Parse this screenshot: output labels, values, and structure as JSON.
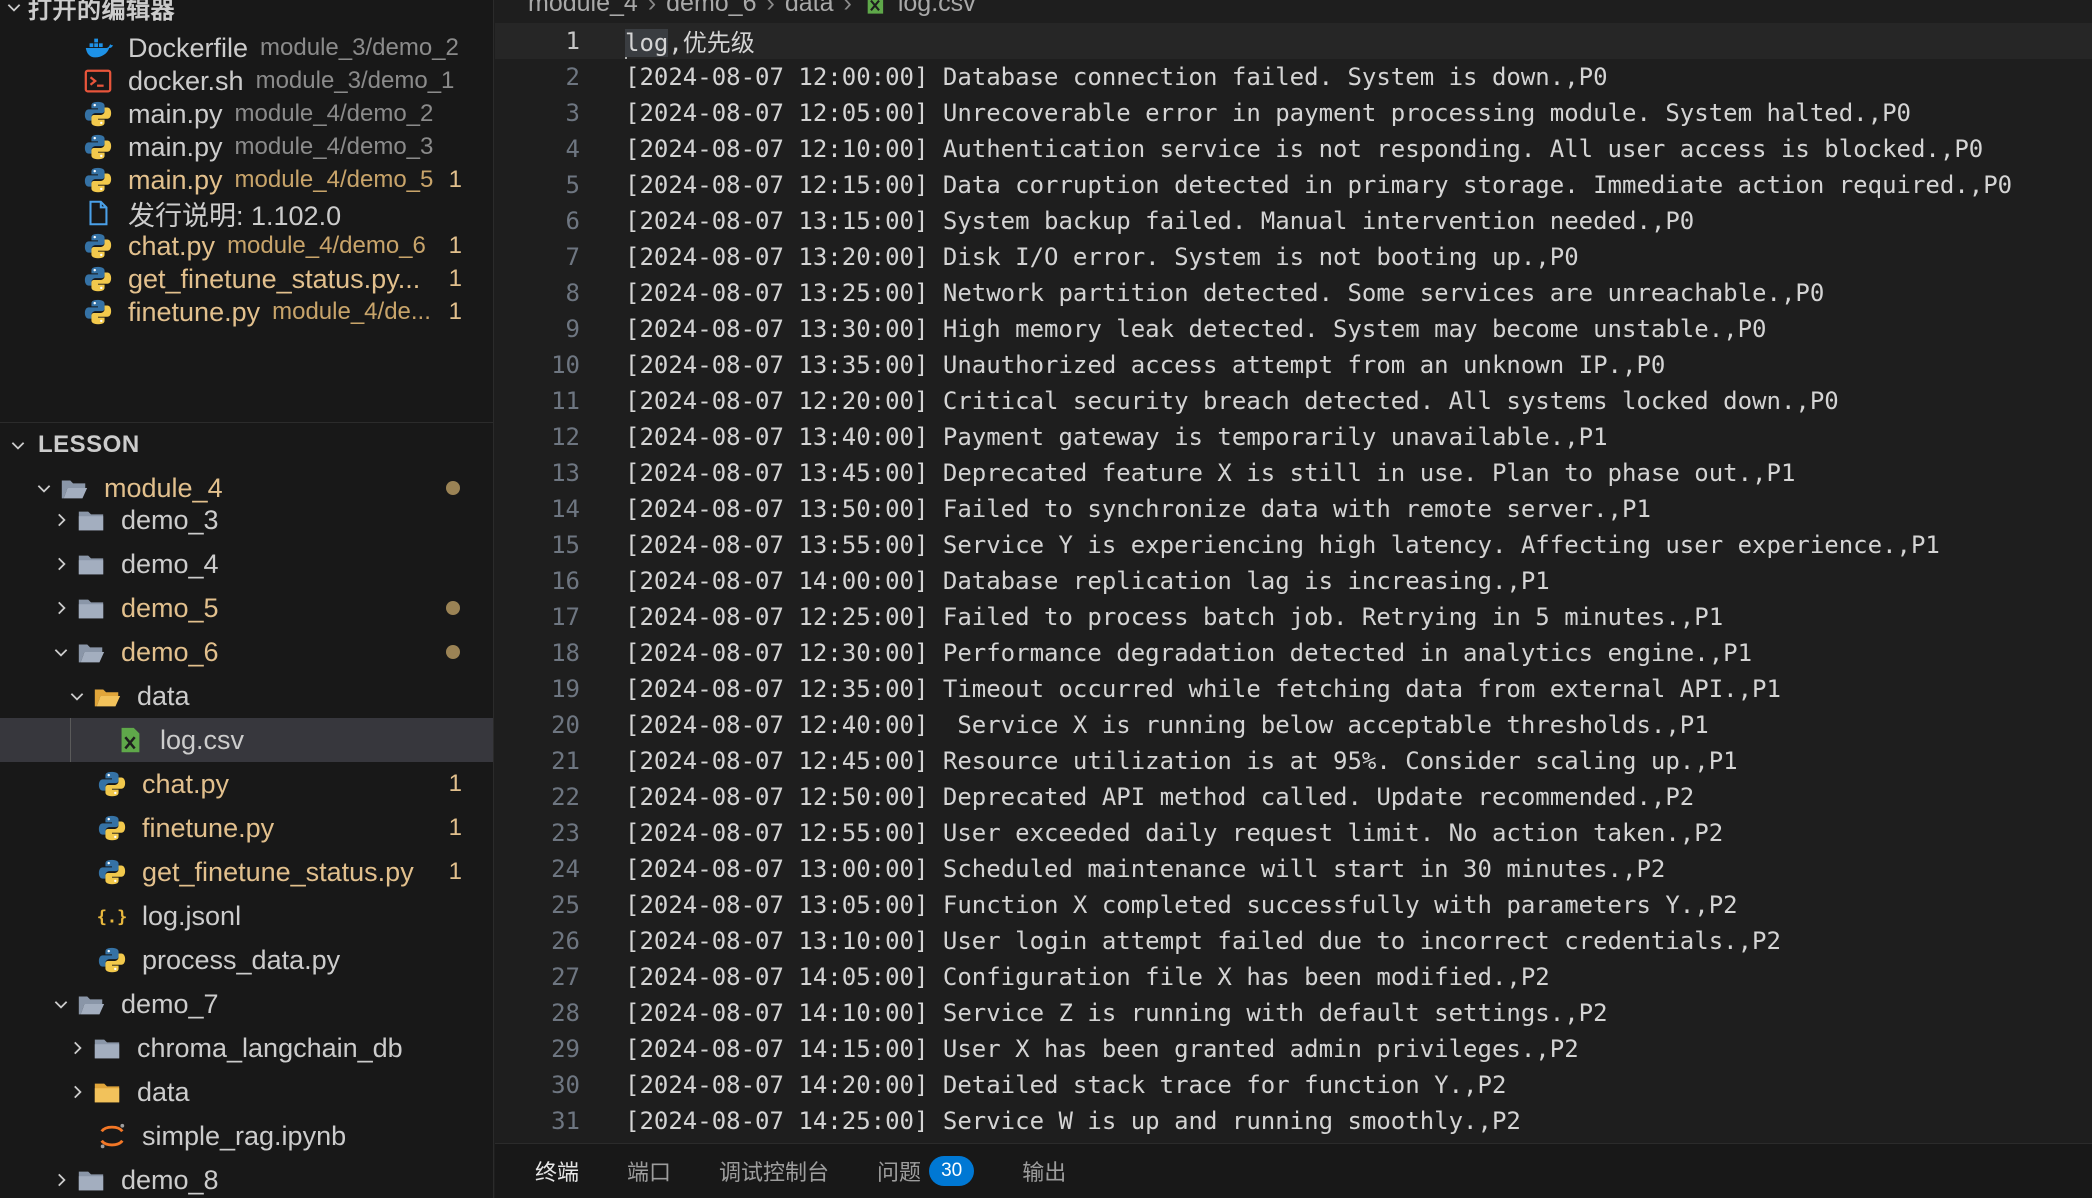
{
  "sidebar": {
    "open_editors_title": "打开的编辑器",
    "open_editors": [
      {
        "name": "Dockerfile",
        "desc": "module_3/demo_2",
        "icon": "docker-icon"
      },
      {
        "name": "docker.sh",
        "desc": "module_3/demo_1",
        "icon": "shell-icon"
      },
      {
        "name": "main.py",
        "desc": "module_4/demo_2",
        "icon": "python-icon"
      },
      {
        "name": "main.py",
        "desc": "module_4/demo_3",
        "icon": "python-icon"
      },
      {
        "name": "main.py",
        "desc": "module_4/demo_5",
        "badge": "1",
        "icon": "python-icon"
      },
      {
        "name": "发行说明: 1.102.0",
        "desc": "",
        "icon": "document-icon"
      },
      {
        "name": "chat.py",
        "desc": "module_4/demo_6",
        "badge": "1",
        "icon": "python-icon"
      },
      {
        "name": "get_finetune_status.py...",
        "desc": "",
        "badge": "1",
        "icon": "python-icon"
      },
      {
        "name": "finetune.py",
        "desc": "module_4/de...",
        "badge": "1",
        "icon": "python-icon"
      }
    ],
    "lesson_title": "LESSON",
    "tree": [
      {
        "name": "module_4",
        "icon": "folder-open-icon",
        "chevron": "down"
      },
      {
        "name": "demo_3",
        "icon": "folder-icon",
        "chevron": "right"
      },
      {
        "name": "demo_4",
        "icon": "folder-icon",
        "chevron": "right"
      },
      {
        "name": "demo_5",
        "icon": "folder-icon",
        "chevron": "right"
      },
      {
        "name": "demo_6",
        "icon": "folder-open-icon",
        "chevron": "down"
      },
      {
        "name": "data",
        "icon": "data-folder-open-icon",
        "chevron": "down"
      },
      {
        "name": "log.csv",
        "icon": "csv-file-icon"
      },
      {
        "name": "chat.py",
        "icon": "python-icon",
        "badge": "1"
      },
      {
        "name": "finetune.py",
        "icon": "python-icon",
        "badge": "1"
      },
      {
        "name": "get_finetune_status.py",
        "icon": "python-icon",
        "badge": "1"
      },
      {
        "name": "log.jsonl",
        "icon": "json-icon"
      },
      {
        "name": "process_data.py",
        "icon": "python-icon"
      },
      {
        "name": "demo_7",
        "icon": "folder-open-icon",
        "chevron": "down"
      },
      {
        "name": "chroma_langchain_db",
        "icon": "folder-icon",
        "chevron": "right"
      },
      {
        "name": "data",
        "icon": "data-folder-icon",
        "chevron": "right"
      },
      {
        "name": "simple_rag.ipynb",
        "icon": "jupyter-icon"
      },
      {
        "name": "demo_8",
        "icon": "folder-icon",
        "chevron": "right"
      }
    ]
  },
  "breadcrumb": [
    "module_4",
    "demo_6",
    "data",
    "log.csv"
  ],
  "editor": {
    "lines": [
      "log,优先级",
      "[2024-08-07 12:00:00] Database connection failed. System is down.,P0",
      "[2024-08-07 12:05:00] Unrecoverable error in payment processing module. System halted.,P0",
      "[2024-08-07 12:10:00] Authentication service is not responding. All user access is blocked.,P0",
      "[2024-08-07 12:15:00] Data corruption detected in primary storage. Immediate action required.,P0",
      "[2024-08-07 13:15:00] System backup failed. Manual intervention needed.,P0",
      "[2024-08-07 13:20:00] Disk I/O error. System is not booting up.,P0",
      "[2024-08-07 13:25:00] Network partition detected. Some services are unreachable.,P0",
      "[2024-08-07 13:30:00] High memory leak detected. System may become unstable.,P0",
      "[2024-08-07 13:35:00] Unauthorized access attempt from an unknown IP.,P0",
      "[2024-08-07 12:20:00] Critical security breach detected. All systems locked down.,P0",
      "[2024-08-07 13:40:00] Payment gateway is temporarily unavailable.,P1",
      "[2024-08-07 13:45:00] Deprecated feature X is still in use. Plan to phase out.,P1",
      "[2024-08-07 13:50:00] Failed to synchronize data with remote server.,P1",
      "[2024-08-07 13:55:00] Service Y is experiencing high latency. Affecting user experience.,P1",
      "[2024-08-07 14:00:00] Database replication lag is increasing.,P1",
      "[2024-08-07 12:25:00] Failed to process batch job. Retrying in 5 minutes.,P1",
      "[2024-08-07 12:30:00] Performance degradation detected in analytics engine.,P1",
      "[2024-08-07 12:35:00] Timeout occurred while fetching data from external API.,P1",
      "[2024-08-07 12:40:00]  Service X is running below acceptable thresholds.,P1",
      "[2024-08-07 12:45:00] Resource utilization is at 95%. Consider scaling up.,P1",
      "[2024-08-07 12:50:00] Deprecated API method called. Update recommended.,P2",
      "[2024-08-07 12:55:00] User exceeded daily request limit. No action taken.,P2",
      "[2024-08-07 13:00:00] Scheduled maintenance will start in 30 minutes.,P2",
      "[2024-08-07 13:05:00] Function X completed successfully with parameters Y.,P2",
      "[2024-08-07 13:10:00] User login attempt failed due to incorrect credentials.,P2",
      "[2024-08-07 14:05:00] Configuration file X has been modified.,P2",
      "[2024-08-07 14:10:00] Service Z is running with default settings.,P2",
      "[2024-08-07 14:15:00] User X has been granted admin privileges.,P2",
      "[2024-08-07 14:20:00] Detailed stack trace for function Y.,P2",
      "[2024-08-07 14:25:00] Service W is up and running smoothly.,P2"
    ]
  },
  "panel": {
    "tabs": [
      "终端",
      "端口",
      "调试控制台",
      "问题",
      "输出"
    ],
    "problems_count": "30"
  },
  "colors": {
    "modified": "#e2c08d",
    "badge_blue": "#0078d4",
    "python_blue": "#3572a5",
    "python_yellow": "#f2c94c",
    "folder": "#8a96a8",
    "csv_green": "#5fa84a"
  }
}
